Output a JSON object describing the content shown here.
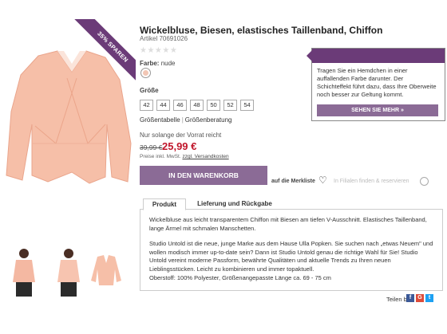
{
  "product": {
    "title": "Wickelbluse, Biesen, elastisches Taillenband, Chiffon",
    "article_number": "Artikel 70691026",
    "rating_stars": "★★★★★",
    "discount_badge": "35% SPAREN",
    "color_label": "Farbe:",
    "color_value": "nude",
    "size_label": "Größe",
    "sizes": [
      "42",
      "44",
      "46",
      "48",
      "50",
      "52",
      "54"
    ],
    "size_table_link": "Größentabelle",
    "size_advice_link": "Größenberatung",
    "stock_note": "Nur solange der Vorrat reicht",
    "old_price": "39,99 €",
    "new_price": "25,99 €",
    "price_note_prefix": "Preise inkl. MwSt. ",
    "price_note_link": "zzgl. Versandkosten",
    "add_to_cart": "IN DEN WARENKORB",
    "wishlist": "auf die Merkliste",
    "store_finder": "In Filialen finden & reservieren"
  },
  "tip": {
    "text": "Tragen Sie ein Hemdchen in einer auffallenden Farbe darunter. Der Schichteffekt führt dazu, dass Ihre Oberweite noch besser zur Geltung kommt.",
    "button": "SEHEN SIE MEHR »"
  },
  "tabs": {
    "tab1": "Produkt",
    "tab2": "Lieferung und Rückgabe"
  },
  "description": {
    "p1": "Wickelbluse aus leicht transparentem Chiffon mit Biesen am tiefen V-Ausschnitt. Elastisches Taillenband, lange Ärmel mit schmalen Manschetten.",
    "p2": "Studio Untold ist die neue, junge Marke aus dem Hause Ulla Popken. Sie suchen nach „etwas Neuem\" und wollen modisch immer up-to-date sein? Dann ist Studio Untold genau die richtige Wahl für Sie! Studio Untold vereint moderne Passform, bewährte Qualitäten und aktuelle Trends zu Ihren neuen Lieblingsstücken. Leicht zu kombinieren und immer topaktuell.",
    "p3": "Oberstoff: 100% Polyester, Größenangepasste Länge ca. 69 - 75 cm"
  },
  "share": {
    "label": "Teilen bei",
    "icons": [
      "f",
      "G",
      "t"
    ]
  },
  "colors": {
    "accent": "#6b3b78",
    "button": "#8b6b96",
    "price": "#c0162b",
    "blouse": "#f4b8a2"
  }
}
